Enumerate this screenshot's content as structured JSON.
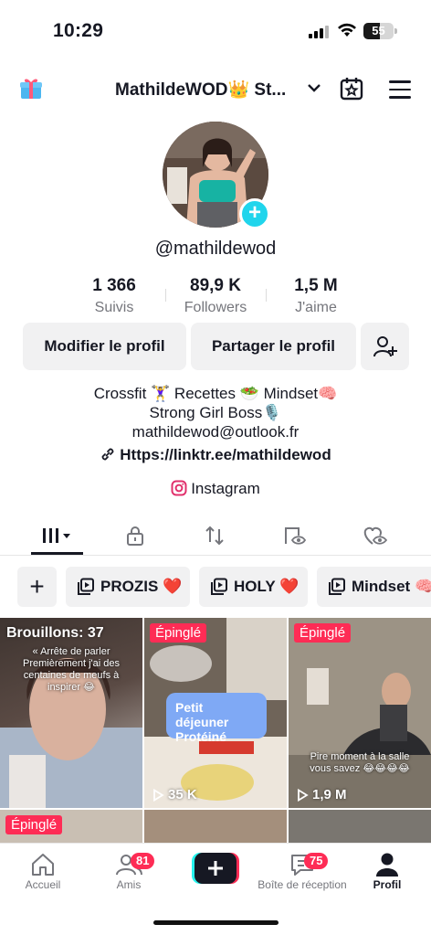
{
  "status": {
    "time": "10:29",
    "battery": "55",
    "battery_level": 0.55
  },
  "header": {
    "title": "MathildeWOD👑 St..."
  },
  "profile": {
    "handle": "@mathildewod",
    "stats": [
      {
        "value": "1 366",
        "label": "Suivis"
      },
      {
        "value": "89,9 K",
        "label": "Followers"
      },
      {
        "value": "1,5 M",
        "label": "J'aime"
      }
    ],
    "edit_label": "Modifier le profil",
    "share_label": "Partager le profil",
    "bio_line1": "Crossfit 🏋️‍♀️ Recettes 🥗 Mindset🧠",
    "bio_line2": "Strong Girl Boss🎙️",
    "bio_line3": "mathildewod@outlook.fr",
    "link": "Https://linktr.ee/mathildewod",
    "instagram": "Instagram"
  },
  "playlists": [
    "PROZIS ❤️",
    "HOLY ❤️",
    "Mindset 🧠"
  ],
  "grid": {
    "drafts": "Brouillons: 37",
    "draft_caption": "« Arrête de parler\nPremièrement j'ai des centaines de meufs à inspirer 😂",
    "pinned": "Épinglé",
    "sticker": "Petit déjeuner Protéiné",
    "views1": "35 K",
    "views2": "1,9 M",
    "caption2": "Pire moment à la salle\nvous savez 😂😂😂😂"
  },
  "nav": {
    "home": "Accueil",
    "friends": "Amis",
    "friends_badge": "81",
    "inbox": "Boîte de réception",
    "inbox_badge": "75",
    "profile": "Profil"
  }
}
